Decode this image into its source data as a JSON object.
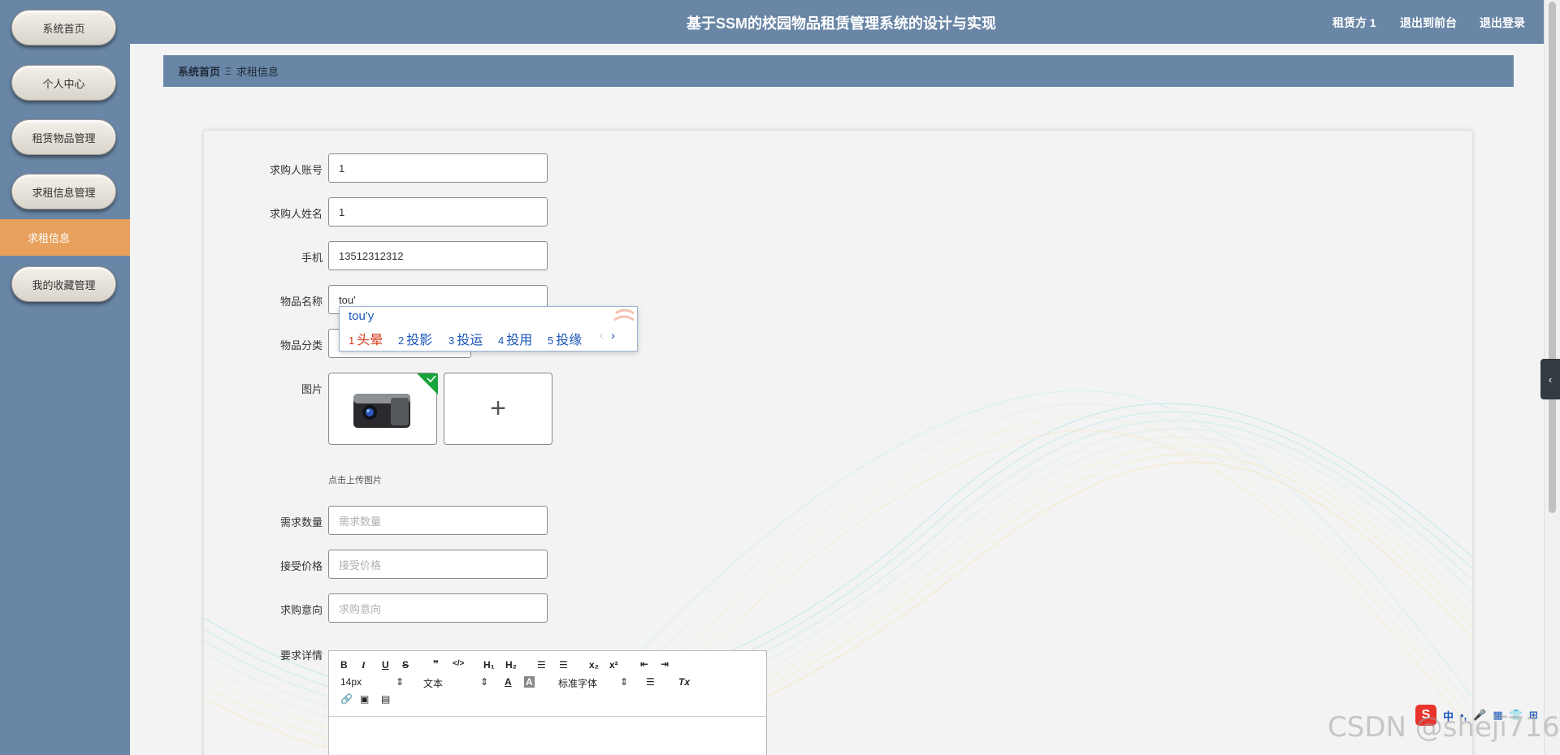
{
  "header": {
    "title": "基于SSM的校园物品租赁管理系统的设计与实现",
    "user": "租赁方 1",
    "to_front": "退出到前台",
    "logout": "退出登录"
  },
  "sidebar": {
    "items": [
      {
        "label": "系统首页"
      },
      {
        "label": "个人中心"
      },
      {
        "label": "租赁物品管理"
      },
      {
        "label": "求租信息管理"
      },
      {
        "label": "求租信息",
        "active": true
      },
      {
        "label": "我的收藏管理"
      }
    ]
  },
  "breadcrumb": {
    "home": "系统首页",
    "sep": "Ξ",
    "current": "求租信息"
  },
  "form": {
    "account_label": "求购人账号",
    "account_value": "1",
    "name_label": "求购人姓名",
    "name_value": "1",
    "phone_label": "手机",
    "phone_value": "13512312312",
    "item_label": "物品名称",
    "item_value": "tou'",
    "category_label": "物品分类",
    "image_label": "图片",
    "upload_hint": "点击上传图片",
    "add_icon": "+",
    "qty_label": "需求数量",
    "qty_placeholder": "需求数量",
    "price_label": "接受价格",
    "price_placeholder": "接受价格",
    "intent_label": "求购意向",
    "intent_placeholder": "求购意向",
    "detail_label": "要求详情"
  },
  "editor": {
    "bold": "B",
    "italic": "I",
    "underline": "U",
    "strike": "S",
    "quote": "❞",
    "code": "</>",
    "h1": "H₁",
    "h2": "H₂",
    "ol": "☰",
    "ul": "☰",
    "sub": "x₂",
    "sup": "x²",
    "indent_out": "⇤",
    "indent_in": "⇥",
    "font_size": "14px",
    "block": "文本",
    "font_color": "A",
    "bg_color": "A",
    "font_family": "标准字体",
    "align": "☰",
    "clean": "Tx",
    "link": "🔗",
    "image": "▣",
    "video": "▤"
  },
  "ime": {
    "composition": "tou'y",
    "candidates": [
      {
        "num": "1",
        "text": "头晕"
      },
      {
        "num": "2",
        "text": "投影"
      },
      {
        "num": "3",
        "text": "投运"
      },
      {
        "num": "4",
        "text": "投用"
      },
      {
        "num": "5",
        "text": "投缘"
      }
    ],
    "prev": "‹",
    "next": "›",
    "bar_logo": "S",
    "bar_items": [
      "中",
      "•,",
      "🎤",
      "▦",
      "👕",
      "⊞"
    ]
  },
  "watermark": "CSDN @shejī716",
  "colors": {
    "primary": "#6986a6",
    "active": "#e8a05d",
    "ime_first": "#d43a1a",
    "ime_text": "#1a56b8"
  }
}
